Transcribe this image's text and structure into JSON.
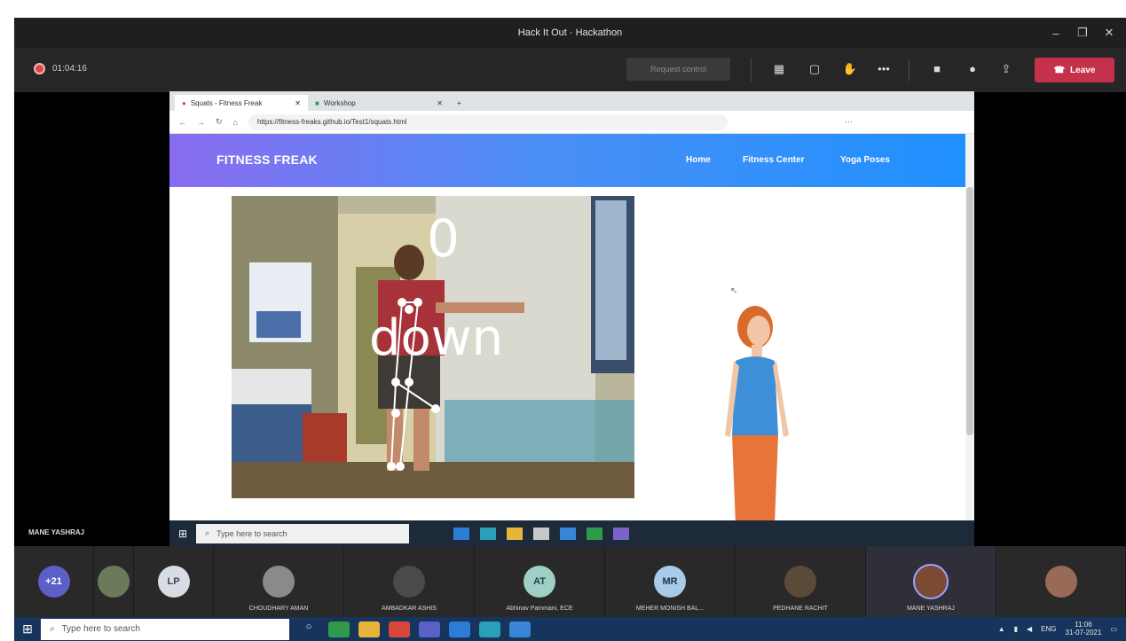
{
  "window": {
    "title": "Hack It Out · Hackathon"
  },
  "toolbar": {
    "recording_time": "01:04:16",
    "request_control_label": "Request control",
    "leave_label": "Leave"
  },
  "browser": {
    "tabs": [
      {
        "label": "Squats - Fitness Freak"
      },
      {
        "label": "Workshop"
      }
    ],
    "url": "https://fitness-freaks.github.io/Test1/squats.html"
  },
  "site": {
    "brand": "FITNESS FREAK",
    "nav": [
      "Home",
      "Fitness Center",
      "Yoga Poses"
    ],
    "rep_count": "0",
    "stage": "down"
  },
  "inner_taskbar": {
    "search_placeholder": "Type here to search"
  },
  "presenter_name": "MANE YASHRAJ",
  "participants": [
    {
      "initials": "+21",
      "name": "",
      "color": "#5b5fc7"
    },
    {
      "initials": "",
      "name": "",
      "color": "#6b7a5a"
    },
    {
      "initials": "LP",
      "name": "",
      "color": "#d7dde3"
    },
    {
      "initials": "",
      "name": "CHOUDHARY AMAN",
      "color": "#8a8a8a"
    },
    {
      "initials": "",
      "name": "AMBADKAR ASHIS",
      "color": "#4a4a4a"
    },
    {
      "initials": "AT",
      "name": "Abhinav Pammani, ECE",
      "color": "#9fd0c6"
    },
    {
      "initials": "MR",
      "name": "MEHER MONISH BAL...",
      "color": "#a7cbe8"
    },
    {
      "initials": "",
      "name": "PEDHANE RACHIT",
      "color": "#5a4a3a"
    },
    {
      "initials": "",
      "name": "MANE YASHRAJ",
      "color": "#7b4a32"
    },
    {
      "initials": "",
      "name": "",
      "color": "#9a6a58"
    }
  ],
  "os_taskbar": {
    "search_placeholder": "Type here to search",
    "time": "11:06",
    "date": "31-07-2021",
    "lang": "ENG"
  }
}
